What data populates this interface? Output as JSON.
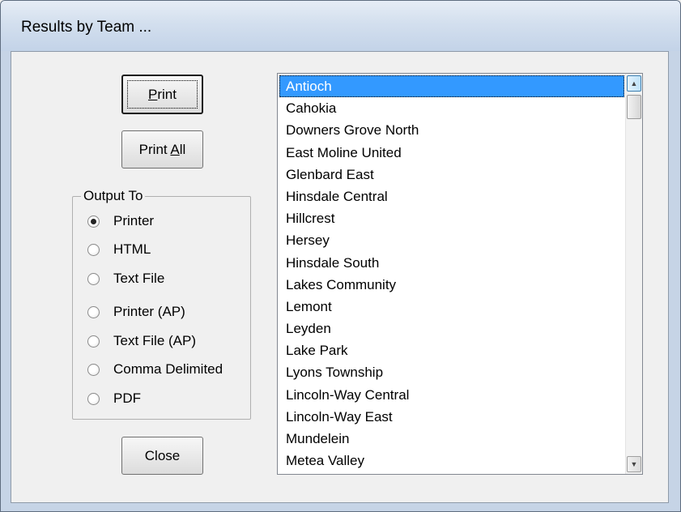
{
  "window": {
    "title": "Results by Team ..."
  },
  "buttons": {
    "print_pre": "",
    "print_mnemonic": "P",
    "print_post": "rint",
    "print_all_pre": "Print ",
    "print_all_mnemonic": "A",
    "print_all_post": "ll",
    "close_label": "Close"
  },
  "output_to": {
    "legend": "Output To",
    "options": [
      {
        "label": "Printer",
        "checked": true
      },
      {
        "label": "HTML",
        "checked": false
      },
      {
        "label": "Text File",
        "checked": false
      },
      {
        "label": "Printer (AP)",
        "checked": false
      },
      {
        "label": "Text File (AP)",
        "checked": false
      },
      {
        "label": "Comma Delimited",
        "checked": false
      },
      {
        "label": "PDF",
        "checked": false
      }
    ]
  },
  "team_list": {
    "selected_index": 0,
    "items": [
      "Antioch",
      "Cahokia",
      "Downers Grove North",
      "East Moline United",
      "Glenbard East",
      "Hinsdale Central",
      "Hillcrest",
      "Hersey",
      "Hinsdale South",
      "Lakes Community",
      "Lemont",
      "Leyden",
      "Lake Park",
      "Lyons Township",
      "Lincoln-Way Central",
      "Lincoln-Way East",
      "Mundelein",
      "Metea Valley"
    ]
  },
  "scrollbar": {
    "up_arrow": "▲",
    "down_arrow": "▼"
  },
  "icons": {
    "scroll_up": "scroll-up-icon",
    "scroll_down": "scroll-down-icon"
  }
}
